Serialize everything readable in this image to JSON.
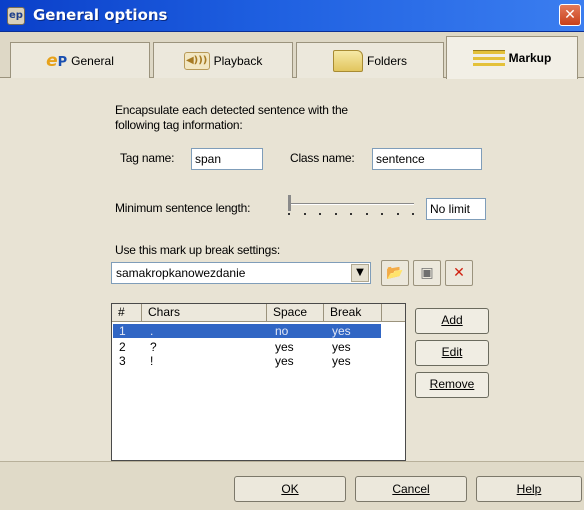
{
  "window": {
    "title": "General options",
    "app_icon": "ep",
    "close_label": "✕"
  },
  "tabs": [
    {
      "label": "General",
      "icon": "ep-logo-icon"
    },
    {
      "label": "Playback",
      "icon": "speaker-icon"
    },
    {
      "label": "Folders",
      "icon": "folder-icon"
    },
    {
      "label": "Markup",
      "icon": "markup-icon",
      "active": true
    }
  ],
  "markup": {
    "intro_line1": "Encapsulate each detected sentence with the",
    "intro_line2": "following tag information:",
    "tag_name_label": "Tag name:",
    "tag_name_value": "span",
    "class_name_label": "Class name:",
    "class_name_value": "sentence",
    "min_length_label": "Minimum sentence length:",
    "min_length_value": "No limit",
    "break_settings_label": "Use this mark up break settings:",
    "break_settings_value": "samakropkanowezdanie"
  },
  "table": {
    "columns": [
      "#",
      "Chars",
      "Space",
      "Break"
    ],
    "rows": [
      {
        "num": "1",
        "chars": ".",
        "space": "no",
        "brk": "yes"
      },
      {
        "num": "2",
        "chars": "?",
        "space": "yes",
        "brk": "yes"
      },
      {
        "num": "3",
        "chars": "!",
        "space": "yes",
        "brk": "yes"
      }
    ]
  },
  "list_buttons": {
    "add": "Add",
    "edit": "Edit",
    "remove": "Remove"
  },
  "footer": {
    "ok": "OK",
    "cancel": "Cancel",
    "help": "Help"
  },
  "colors": {
    "title_bar": "#1e5fe0",
    "selection": "#3166c4",
    "delete_red": "#d02010"
  }
}
